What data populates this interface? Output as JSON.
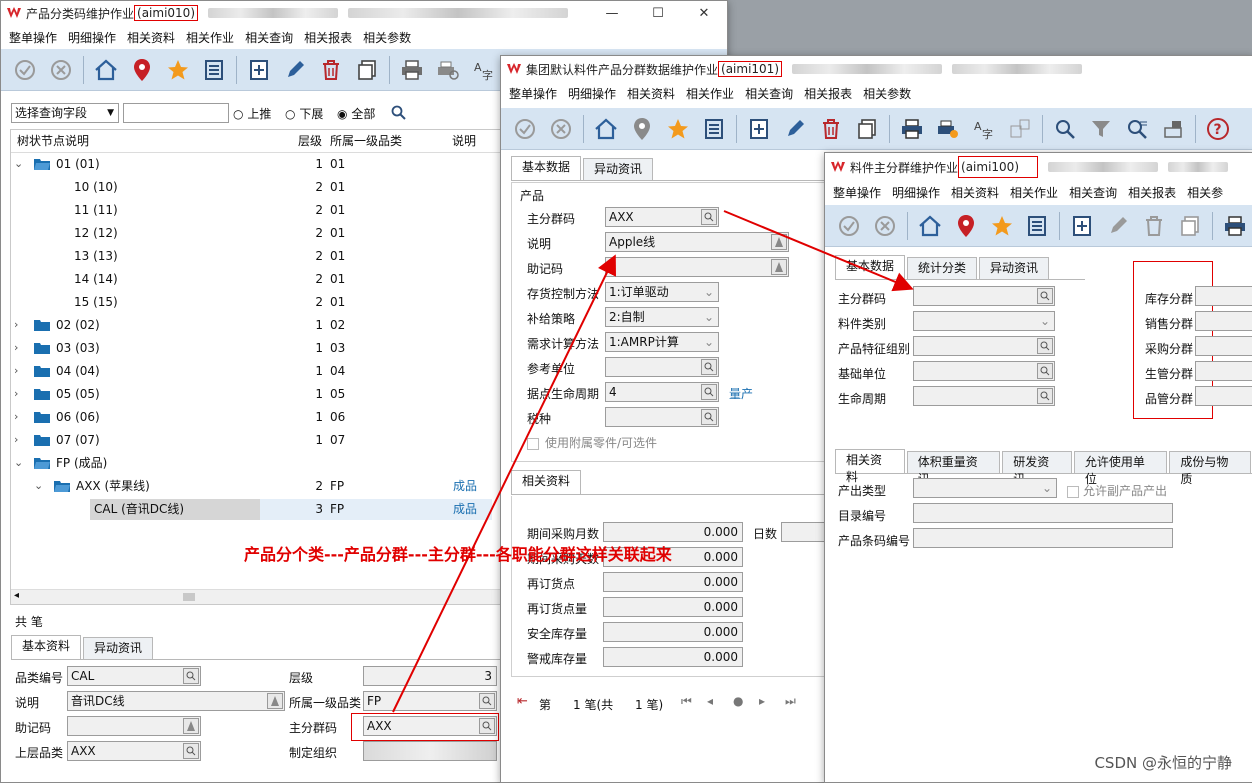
{
  "win1": {
    "title": "产品分类码维护作业",
    "code": "(aimi010)",
    "menu": [
      "整单操作",
      "明细操作",
      "相关资料",
      "相关作业",
      "相关查询",
      "相关报表",
      "相关参数"
    ],
    "search": {
      "field_label": "选择查询字段",
      "radio_up": "上推",
      "radio_down": "下展",
      "radio_all": "全部"
    },
    "tree_headers": [
      "树状节点说明",
      "层级",
      "所属一级品类",
      "说明"
    ],
    "tree_rows": [
      {
        "label": "01 (01)",
        "level": "1",
        "parent": "01",
        "desc": ""
      },
      {
        "label": "10 (10)",
        "level": "2",
        "parent": "01",
        "desc": ""
      },
      {
        "label": "11 (11)",
        "level": "2",
        "parent": "01",
        "desc": ""
      },
      {
        "label": "12 (12)",
        "level": "2",
        "parent": "01",
        "desc": ""
      },
      {
        "label": "13 (13)",
        "level": "2",
        "parent": "01",
        "desc": ""
      },
      {
        "label": "14 (14)",
        "level": "2",
        "parent": "01",
        "desc": ""
      },
      {
        "label": "15 (15)",
        "level": "2",
        "parent": "01",
        "desc": ""
      },
      {
        "label": "02 (02)",
        "level": "1",
        "parent": "02",
        "desc": ""
      },
      {
        "label": "03 (03)",
        "level": "1",
        "parent": "03",
        "desc": ""
      },
      {
        "label": "04 (04)",
        "level": "1",
        "parent": "04",
        "desc": ""
      },
      {
        "label": "05 (05)",
        "level": "1",
        "parent": "05",
        "desc": ""
      },
      {
        "label": "06 (06)",
        "level": "1",
        "parent": "06",
        "desc": ""
      },
      {
        "label": "07 (07)",
        "level": "1",
        "parent": "07",
        "desc": ""
      },
      {
        "label": "FP (成品)",
        "level": "",
        "parent": "",
        "desc": ""
      },
      {
        "label": "AXX (苹果线)",
        "level": "2",
        "parent": "FP",
        "desc": "成品"
      },
      {
        "label": "CAL (音讯DC线)",
        "level": "3",
        "parent": "FP",
        "desc": "成品"
      }
    ],
    "count_label": "共    笔",
    "tabs": [
      "基本资料",
      "异动资讯"
    ],
    "form": {
      "code_label": "品类编号",
      "code_value": "CAL",
      "desc_label": "说明",
      "desc_value": "音讯DC线",
      "memo_label": "助记码",
      "memo_value": "",
      "upper_label": "上层品类",
      "upper_value": "AXX",
      "level_label": "层级",
      "level_value": "3",
      "first_label": "所属一级品类",
      "first_value": "FP",
      "main_label": "主分群码",
      "main_value": "AXX",
      "org_label": "制定组织",
      "org_value": ""
    }
  },
  "win2": {
    "title": "集团默认料件产品分群数据维护作业",
    "code": "(aimi101)",
    "menu": [
      "整单操作",
      "明细操作",
      "相关资料",
      "相关作业",
      "相关查询",
      "相关报表",
      "相关参数"
    ],
    "tabs": [
      "基本数据",
      "异动资讯"
    ],
    "group_product": "产品",
    "fields": {
      "main_label": "主分群码",
      "main_value": "AXX",
      "desc_label": "说明",
      "desc_value": "Apple线",
      "memo_label": "助记码",
      "memo_value": "",
      "stock_label": "存货控制方法",
      "stock_value": "1:订单驱动",
      "supply_label": "补给策略",
      "supply_value": "2:自制",
      "demand_label": "需求计算方法",
      "demand_value": "1:AMRP计算",
      "unit_label": "参考单位",
      "unit_value": "",
      "life_label": "据点生命周期",
      "life_value": "4",
      "life_extra": "量产",
      "tax_label": "税种",
      "tax_value": "",
      "attach_label": "使用附属零件/可选件"
    },
    "related_tab": "相关资料",
    "related": [
      {
        "label": "期间采购月数",
        "value": "0.000"
      },
      {
        "label": "期间采购天数",
        "value": "0.000"
      },
      {
        "label": "再订货点",
        "value": "0.000"
      },
      {
        "label": "再订货点量",
        "value": "0.000"
      },
      {
        "label": "安全库存量",
        "value": "0.000"
      },
      {
        "label": "警戒库存量",
        "value": "0.000"
      }
    ],
    "days_label": "日数",
    "pager": {
      "first": "第",
      "count": "1 笔(共",
      "total": "1 笔)"
    }
  },
  "win3": {
    "title": "料件主分群维护作业",
    "code": "(aimi100)",
    "menu": [
      "整单操作",
      "明细操作",
      "相关资料",
      "相关作业",
      "相关查询",
      "相关报表",
      "相关参"
    ],
    "tabs": [
      "基本数据",
      "统计分类",
      "异动资讯"
    ],
    "fields": {
      "main_label": "主分群码",
      "type_label": "料件类别",
      "feature_label": "产品特征组别",
      "base_label": "基础单位",
      "life_label": "生命周期"
    },
    "right_labels": [
      "库存分群",
      "销售分群",
      "采购分群",
      "生管分群",
      "品管分群"
    ],
    "tabs2": [
      "相关资料",
      "体积重量资讯",
      "研发资讯",
      "允许使用单位",
      "成份与物质"
    ],
    "related": {
      "out_label": "产出类型",
      "by_label": "允许副产品产出",
      "dir_label": "目录编号",
      "bar_label": "产品条码编号"
    }
  },
  "annotation": "产品分个类---产品分群---主分群---各职能分群这样关联起来",
  "watermark": "CSDN @永恒的宁静",
  "colors": {
    "accent_red": "#e00000",
    "toolbar": "#d6e4f2",
    "link": "#1a6fb0"
  }
}
